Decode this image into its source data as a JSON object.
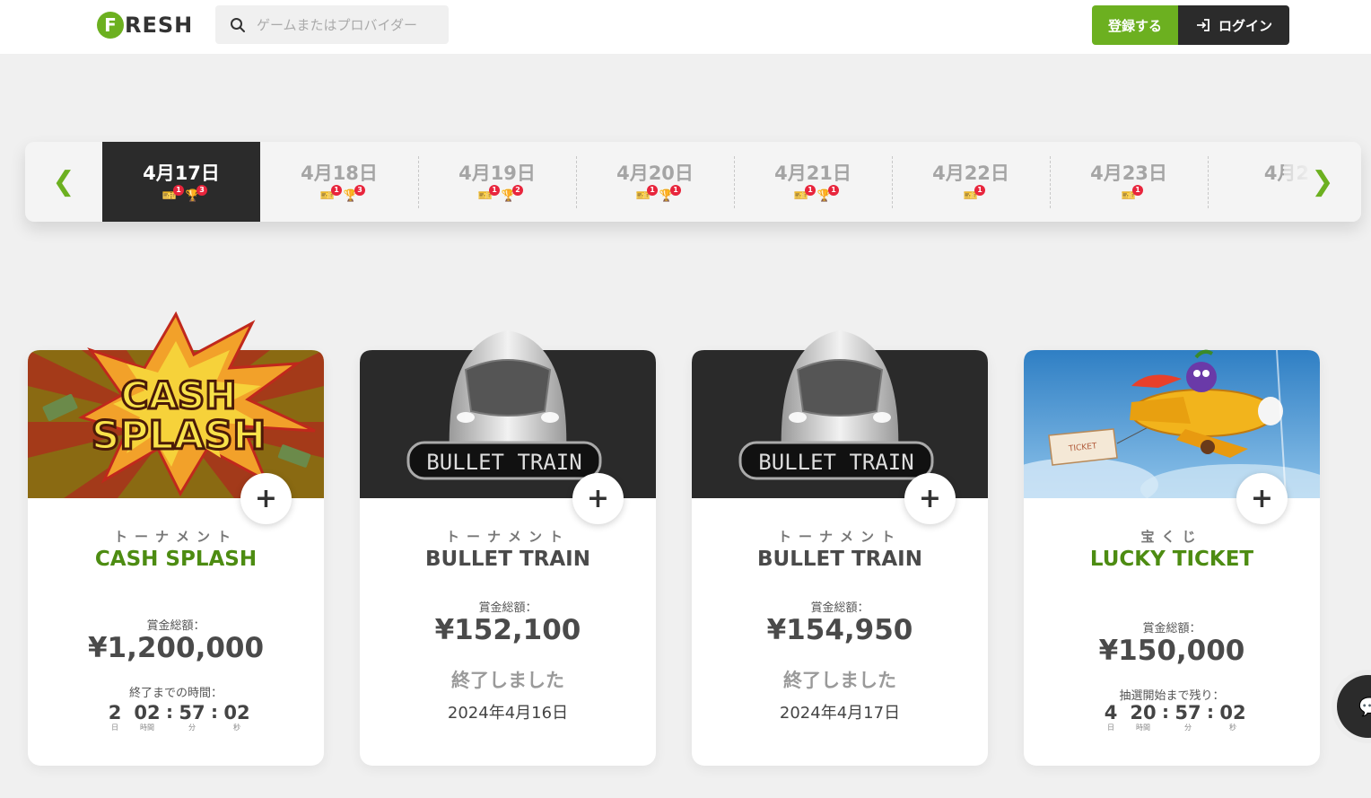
{
  "header": {
    "logo_letter": "F",
    "logo_text": "RESH",
    "search_placeholder": "ゲームまたはプロバイダー",
    "register_label": "登録する",
    "login_label": "ログイン",
    "brand_color": "#6cb020"
  },
  "date_strip": {
    "prev_icon": "chevron-left-icon",
    "next_icon": "chevron-right-icon",
    "days": [
      {
        "label": "4月17日",
        "active": true,
        "ticket_count": "1",
        "trophy_count": "3"
      },
      {
        "label": "4月18日",
        "active": false,
        "ticket_count": "1",
        "trophy_count": "3"
      },
      {
        "label": "4月19日",
        "active": false,
        "ticket_count": "1",
        "trophy_count": "2"
      },
      {
        "label": "4月20日",
        "active": false,
        "ticket_count": "1",
        "trophy_count": "1"
      },
      {
        "label": "4月21日",
        "active": false,
        "ticket_count": "1",
        "trophy_count": "1"
      },
      {
        "label": "4月22日",
        "active": false,
        "ticket_count": "1",
        "trophy_count": null
      },
      {
        "label": "4月23日",
        "active": false,
        "ticket_count": "1",
        "trophy_count": null
      },
      {
        "label": "4月2",
        "active": false,
        "ticket_count": null,
        "trophy_count": null
      }
    ]
  },
  "cards": [
    {
      "image": "cash-splash",
      "image_text": [
        "CASH",
        "SPLASH"
      ],
      "kind": "トーナメント",
      "title": "CASH SPLASH",
      "prize_label": "賞金総額：",
      "prize": "¥1,200,000",
      "timer_label": "終了までの時間：",
      "timer": {
        "d": "2",
        "h": "02",
        "m": "57",
        "s": "02",
        "d_unit": "日",
        "h_unit": "時間",
        "m_unit": "分",
        "s_unit": "秒"
      }
    },
    {
      "image": "bullet-train",
      "image_text": "BULLET TRAIN",
      "kind": "トーナメント",
      "title": "BULLET TRAIN",
      "prize_label": "賞金総額：",
      "prize": "¥152,100",
      "status": "終了しました",
      "end_date": "2024年4月16日"
    },
    {
      "image": "bullet-train",
      "image_text": "BULLET TRAIN",
      "kind": "トーナメント",
      "title": "BULLET TRAIN",
      "prize_label": "賞金総額：",
      "prize": "¥154,950",
      "status": "終了しました",
      "end_date": "2024年4月17日"
    },
    {
      "image": "lucky-ticket",
      "image_text": "TICKET",
      "kind": "宝くじ",
      "title": "LUCKY TICKET",
      "prize_label": "賞金総額：",
      "prize": "¥150,000",
      "timer_label": "抽選開始まで残り：",
      "timer": {
        "d": "4",
        "h": "20",
        "m": "57",
        "s": "02",
        "d_unit": "日",
        "h_unit": "時間",
        "m_unit": "分",
        "s_unit": "秒"
      }
    }
  ],
  "chat_icon": "chat-icon"
}
